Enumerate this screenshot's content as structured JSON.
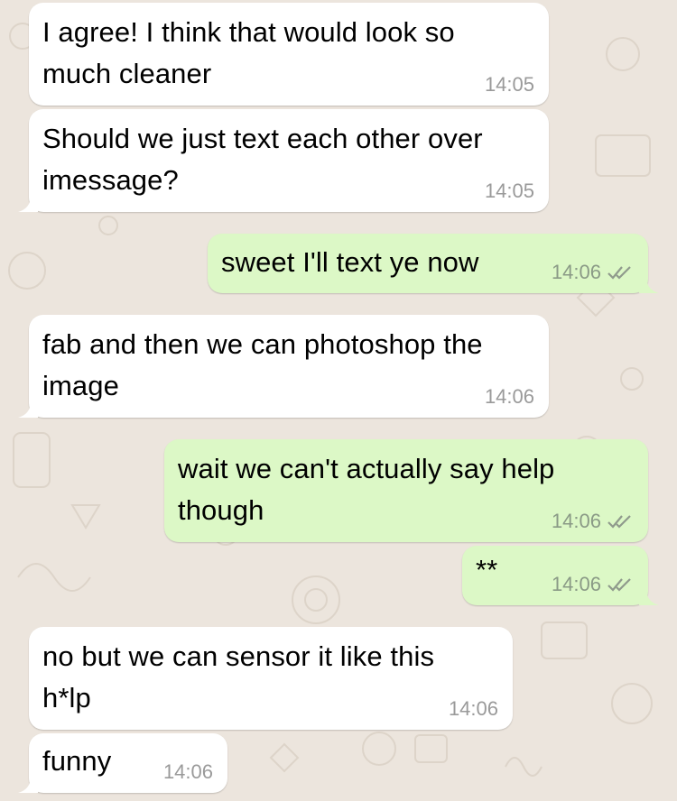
{
  "chat": {
    "colors": {
      "background": "#ece5dd",
      "incoming_bubble": "#ffffff",
      "outgoing_bubble": "#dcf8c6",
      "timestamp": "#9a9a9a",
      "tick": "#8f9a8c"
    },
    "messages": [
      {
        "direction": "incoming",
        "text": "I agree! I think that would look so\nmuch cleaner",
        "time": "14:05"
      },
      {
        "direction": "incoming",
        "text": "Should we just text each other over\nimessage?",
        "time": "14:05"
      },
      {
        "direction": "outgoing",
        "text": "sweet I'll text ye now",
        "time": "14:06",
        "status_icon": "double-check-icon"
      },
      {
        "direction": "incoming",
        "text": "fab and then we can photoshop the\nimage",
        "time": "14:06"
      },
      {
        "direction": "outgoing",
        "text": "wait we can't actually say help\nthough",
        "time": "14:06",
        "status_icon": "double-check-icon"
      },
      {
        "direction": "outgoing",
        "text": "**",
        "time": "14:06",
        "status_icon": "double-check-icon"
      },
      {
        "direction": "incoming",
        "text": "no but we can sensor it like this\nh*lp",
        "time": "14:06"
      },
      {
        "direction": "incoming",
        "text": "funny",
        "time": "14:06"
      }
    ]
  }
}
